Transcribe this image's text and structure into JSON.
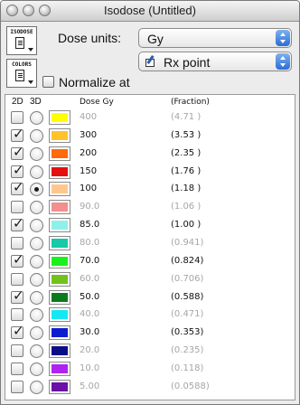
{
  "window": {
    "title": "Isodose (Untitled)"
  },
  "toolbar": {
    "isodose_button_label": "ISODOSE",
    "colors_button_label": "COLORS",
    "dose_units_label": "Dose units:",
    "dose_units_value": "Gy",
    "normalize_label": "Normalize at",
    "normalize_checked": false,
    "normalize_value": "Rx point"
  },
  "columns": {
    "col_2d": "2D",
    "col_3d": "3D",
    "col_dose": "Dose Gy",
    "col_fraction": "(Fraction)"
  },
  "rows": [
    {
      "dose": "400",
      "fraction": "(4.71 )",
      "checked_2d": false,
      "selected_3d": false,
      "color": "#ffff00"
    },
    {
      "dose": "300",
      "fraction": "(3.53 )",
      "checked_2d": true,
      "selected_3d": false,
      "color": "#ffc32a"
    },
    {
      "dose": "200",
      "fraction": "(2.35 )",
      "checked_2d": true,
      "selected_3d": false,
      "color": "#ff6a0a"
    },
    {
      "dose": "150",
      "fraction": "(1.76 )",
      "checked_2d": true,
      "selected_3d": false,
      "color": "#e41010"
    },
    {
      "dose": "100",
      "fraction": "(1.18 )",
      "checked_2d": true,
      "selected_3d": true,
      "color": "#ffc78e"
    },
    {
      "dose": "90.0",
      "fraction": "(1.06 )",
      "checked_2d": false,
      "selected_3d": false,
      "color": "#f28f8f"
    },
    {
      "dose": "85.0",
      "fraction": "(1.00 )",
      "checked_2d": true,
      "selected_3d": false,
      "color": "#8ff0ea"
    },
    {
      "dose": "80.0",
      "fraction": "(0.941)",
      "checked_2d": false,
      "selected_3d": false,
      "color": "#17c9a6"
    },
    {
      "dose": "70.0",
      "fraction": "(0.824)",
      "checked_2d": true,
      "selected_3d": false,
      "color": "#1cf01c"
    },
    {
      "dose": "60.0",
      "fraction": "(0.706)",
      "checked_2d": false,
      "selected_3d": false,
      "color": "#72c21c"
    },
    {
      "dose": "50.0",
      "fraction": "(0.588)",
      "checked_2d": true,
      "selected_3d": false,
      "color": "#0a7a1e"
    },
    {
      "dose": "40.0",
      "fraction": "(0.471)",
      "checked_2d": false,
      "selected_3d": false,
      "color": "#14e8f2"
    },
    {
      "dose": "30.0",
      "fraction": "(0.353)",
      "checked_2d": true,
      "selected_3d": false,
      "color": "#0b1ecf"
    },
    {
      "dose": "20.0",
      "fraction": "(0.235)",
      "checked_2d": false,
      "selected_3d": false,
      "color": "#0c0c86"
    },
    {
      "dose": "10.0",
      "fraction": "(0.118)",
      "checked_2d": false,
      "selected_3d": false,
      "color": "#b020f2"
    },
    {
      "dose": "5.00",
      "fraction": "(0.0588)",
      "checked_2d": false,
      "selected_3d": false,
      "color": "#6a10a6"
    }
  ],
  "icons": {
    "isodose_button": "document-icon",
    "colors_button": "document-icon",
    "rx_point": "prescription-pen-icon",
    "checkmark": "✓"
  }
}
